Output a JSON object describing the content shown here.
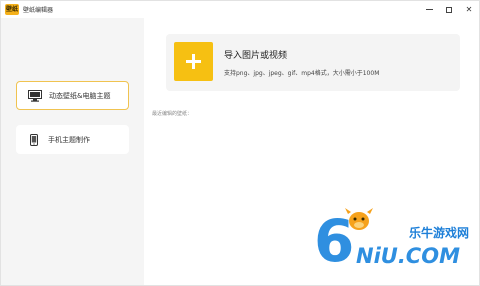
{
  "window": {
    "title": "壁纸编辑器",
    "icon_text": "壁纸",
    "controls": [
      "minimize",
      "maximize",
      "close"
    ],
    "close_glyph": "✕"
  },
  "sidebar": {
    "items": [
      {
        "label": "动态壁纸&电脑主题",
        "icon": "monitor-icon",
        "active": true
      },
      {
        "label": "手机主题制作",
        "icon": "phone-icon",
        "active": false
      }
    ],
    "accent": "#f0c350"
  },
  "main": {
    "import": {
      "title": "导入图片或视频",
      "subtitle": "支持png、jpg、jpeg、gif、mp4格式，大小需小于100M",
      "button_color": "#f6c012"
    },
    "recent_label": "最近编辑的壁纸："
  },
  "watermark": {
    "digit": "6",
    "brand_cn": "乐牛游戏网",
    "brand_en": "NiU.COM"
  }
}
